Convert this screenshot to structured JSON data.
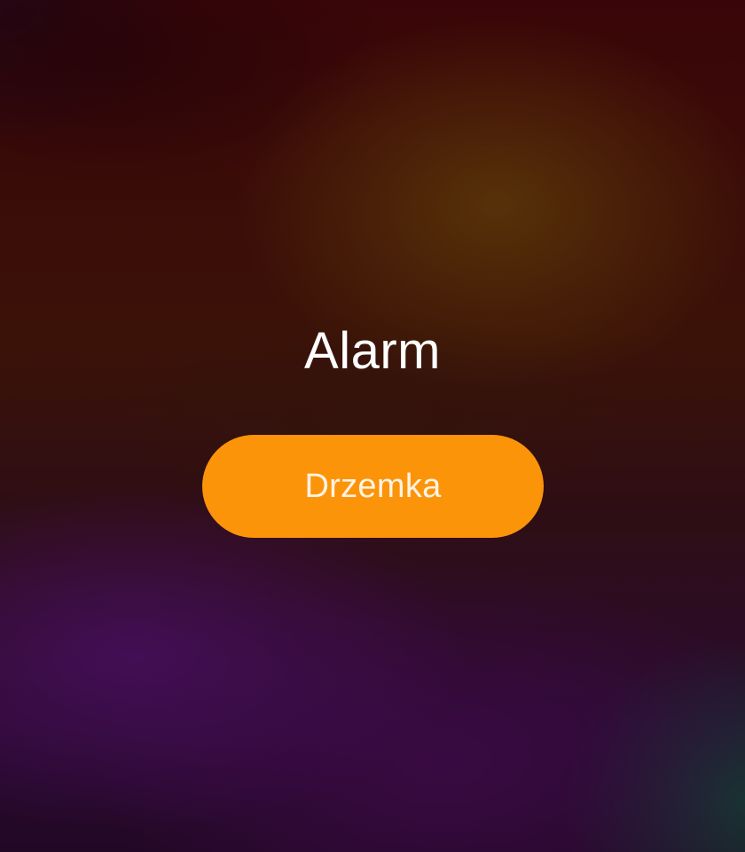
{
  "alarm": {
    "title": "Alarm",
    "snooze_label": "Drzemka"
  },
  "colors": {
    "snooze_button": "#fc940a",
    "title_text": "#ffffff"
  }
}
